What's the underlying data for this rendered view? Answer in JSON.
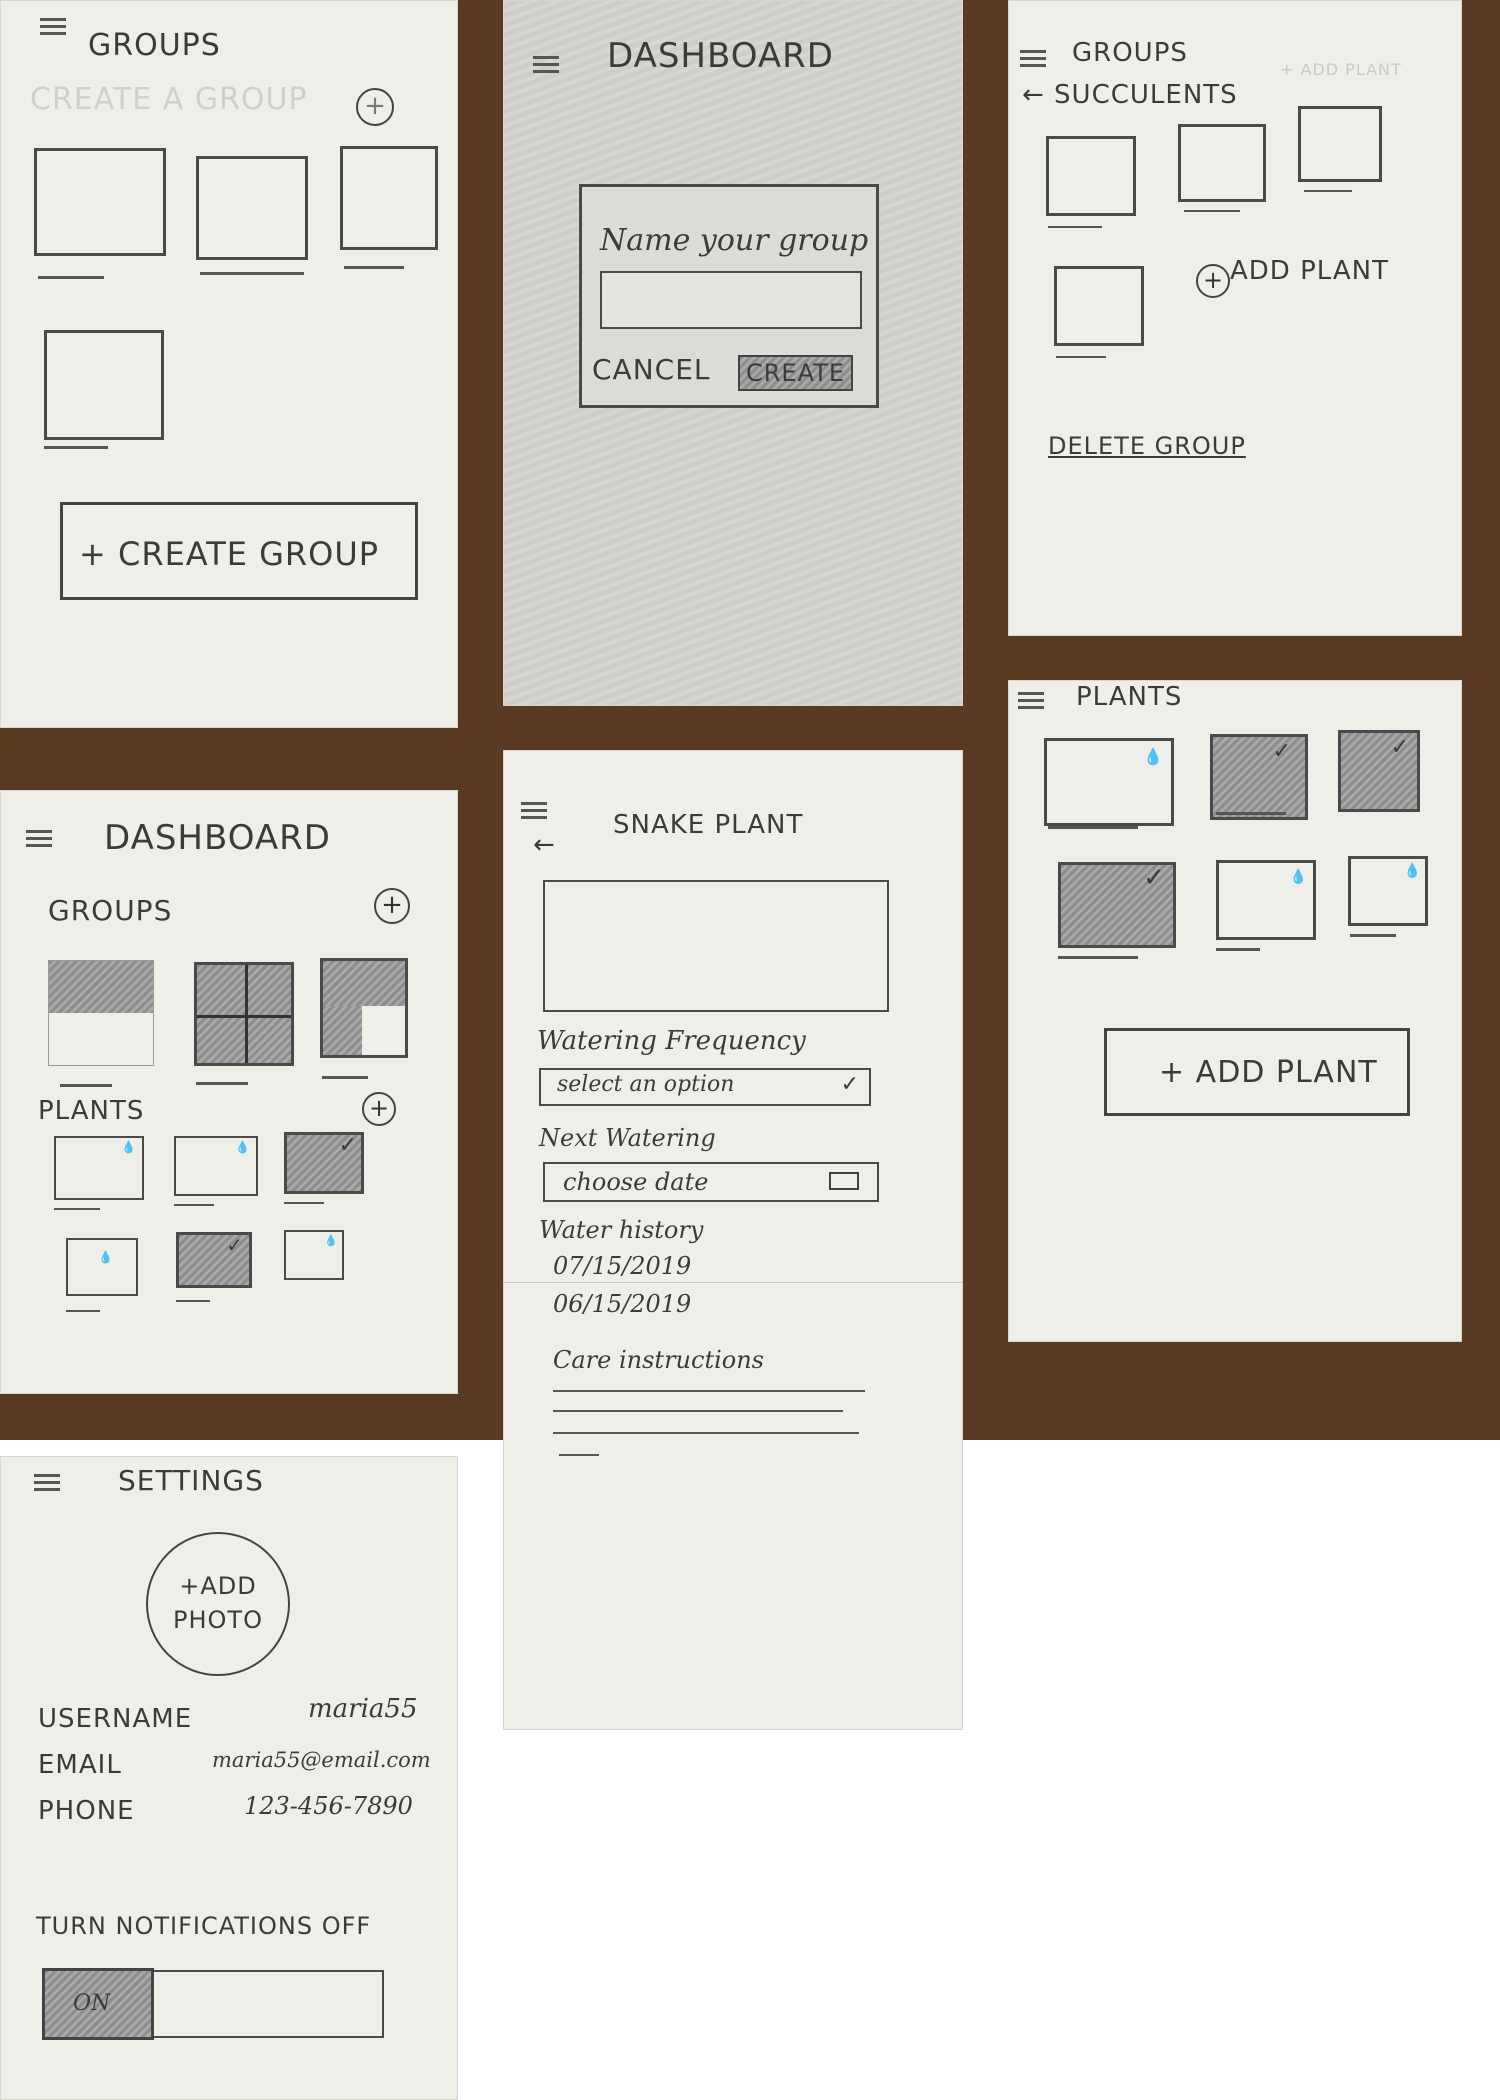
{
  "screens": {
    "groups_empty": {
      "title": "GROUPS",
      "faint_heading": "CREATE A GROUP",
      "create_button": "+ CREATE  GROUP"
    },
    "dashboard_modal": {
      "title": "DASHBOARD",
      "modal_prompt": "Name your group",
      "cancel": "CANCEL",
      "create": "CREATE"
    },
    "succulents": {
      "title": "GROUPS",
      "back_label": "← SUCCULENTS",
      "faint_add": "+ ADD PLANT",
      "add_plant": "ADD PLANT",
      "delete_group": "DELETE GROUP"
    },
    "plants": {
      "title": "PLANTS",
      "add_button": "+ ADD PLANT"
    },
    "dashboard": {
      "title": "DASHBOARD",
      "groups_label": "GROUPS",
      "plants_label": "PLANTS"
    },
    "snake_plant": {
      "back": "←",
      "title": "SNAKE PLANT",
      "watering_label": "Watering Frequency",
      "watering_placeholder": "select an option",
      "next_label": "Next Watering",
      "next_placeholder": "choose date",
      "history_label": "Water history",
      "history": [
        "07/15/2019",
        "06/15/2019"
      ],
      "care_label": "Care instructions"
    },
    "settings": {
      "title": "SETTINGS",
      "photo_line1": "+ADD",
      "photo_line2": "PHOTO",
      "username_label": "USERNAME",
      "username_value": "maria55",
      "email_label": "EMAIL",
      "email_value": "maria55@email.com",
      "phone_label": "PHONE",
      "phone_value": "123-456-7890",
      "notifications_label": "TURN NOTIFICATIONS OFF",
      "toggle_label": "ON"
    }
  },
  "icons": {
    "menu": "hamburger-icon",
    "plus": "plus-icon",
    "water": "water-drop-icon",
    "check": "checkmark-icon",
    "calendar": "calendar-icon"
  }
}
